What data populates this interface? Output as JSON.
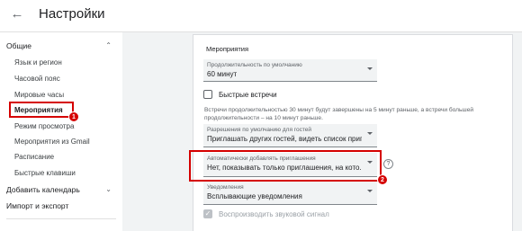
{
  "header": {
    "title": "Настройки",
    "back_icon": "arrow-left-icon"
  },
  "sidebar": {
    "general": "Общие",
    "items": [
      "Язык и регион",
      "Часовой пояс",
      "Мировые часы",
      "Мероприятия",
      "Режим просмотра",
      "Мероприятия из Gmail",
      "Расписание",
      "Быстрые клавиши"
    ],
    "add_calendar": "Добавить календарь",
    "import_export": "Импорт и экспорт",
    "selected": "Мероприятия"
  },
  "badges": {
    "first": "1",
    "second": "2"
  },
  "section": {
    "title": "Мероприятия",
    "duration": {
      "label": "Продолжительность по умолчанию",
      "value": "60 минут"
    },
    "quick_meetings": {
      "label": "Быстрые встречи",
      "checked": false
    },
    "description": "Встречи продолжительностью 30 минут будут завершены на 5 минут раньше, а встречи большей продолжительности – на 10 минут раньше.",
    "guest_permissions": {
      "label": "Разрешения по умолчанию для гостей",
      "value": "Приглашать других гостей, видеть список приг..."
    },
    "auto_add": {
      "label": "Автоматически добавлять приглашения",
      "value": "Нет, показывать только приглашения, на кото..."
    },
    "help_icon": "?",
    "notifications": {
      "label": "Уведомления",
      "value": "Всплывающие уведомления"
    },
    "sound": {
      "label": "Воспроизводить звуковой сигнал",
      "checked": true,
      "check_mark": "✓"
    }
  },
  "colors": {
    "highlight": "#d50000",
    "panel_bg": "#f1f3f4"
  }
}
